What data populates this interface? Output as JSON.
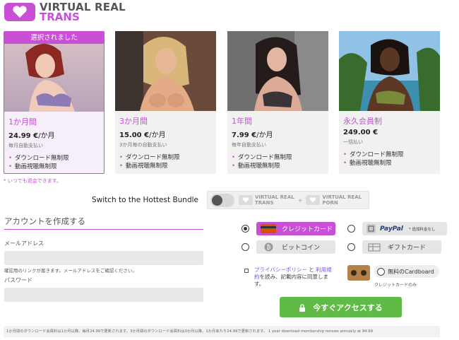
{
  "brand": {
    "line1": "VIRTUAL REAL",
    "line2": "TRANS",
    "accent": "#c84fd6",
    "cta_color": "#5fbb46"
  },
  "plans": [
    {
      "badge": "選択されました",
      "title": "1か月間",
      "price": "24.99 €",
      "unit": "/か月",
      "sub": "毎月自動支払い",
      "features": [
        "ダウンロード無制限",
        "動画視聴無制限"
      ],
      "selected": true
    },
    {
      "badge": "",
      "title": "3か月間",
      "price": "15.00 €",
      "unit": "/か月",
      "sub": "3か月毎の自動支払い",
      "features": [
        "ダウンロード無制限",
        "動画視聴無制限"
      ],
      "selected": false
    },
    {
      "badge": "",
      "title": "1年間",
      "price": "7.99 €",
      "unit": "/か月",
      "sub": "毎年自動支払い",
      "features": [
        "ダウンロード無制限",
        "動画視聴無制限"
      ],
      "selected": false
    },
    {
      "badge": "",
      "title": "永久会員制",
      "price": "249.00 €",
      "unit": "",
      "sub": "一括払い",
      "features": [
        "ダウンロード無制限",
        "動画視聴無制限"
      ],
      "selected": false
    }
  ],
  "cancel_note": "* いつでも退会できます。",
  "bundle": {
    "label": "Switch to the Hottest Bundle",
    "logo1": {
      "line1": "VIRTUAL REAL",
      "line2": "TRANS"
    },
    "plus": "+",
    "logo2": {
      "line1": "VIRTUAL REAL",
      "line2": "PORN"
    }
  },
  "account": {
    "title": "アカウントを作成する",
    "email_label": "メールアドレス",
    "email_value": "",
    "email_hint": "確認用のリンクが届きます。メールアドレスをご確認ください。",
    "password_label": "パスワード",
    "password_value": ""
  },
  "payment": {
    "credit": "クレジットカード",
    "paypal": "PayPal",
    "paypal_note": "* 追加料金なし",
    "bitcoin": "ビットコイン",
    "giftcard": "ギフトカード"
  },
  "terms": {
    "link1": "プライバシーポリシー",
    "and": "と",
    "link2": "利用規約",
    "rest": "を読み、記載内容に同意します。"
  },
  "cardboard": {
    "label": "無料のCardboard",
    "note": "クレジットカードのみ"
  },
  "cta": "今すぐアクセスする",
  "footer": "1か月間のダウンロード会員料は1か月以降、毎月24.99で更新されます。3か月間のダウンロード会員料は3か月以降、1か月あたり24.99で更新されます。  1 year download membership renews annually at 94.99"
}
